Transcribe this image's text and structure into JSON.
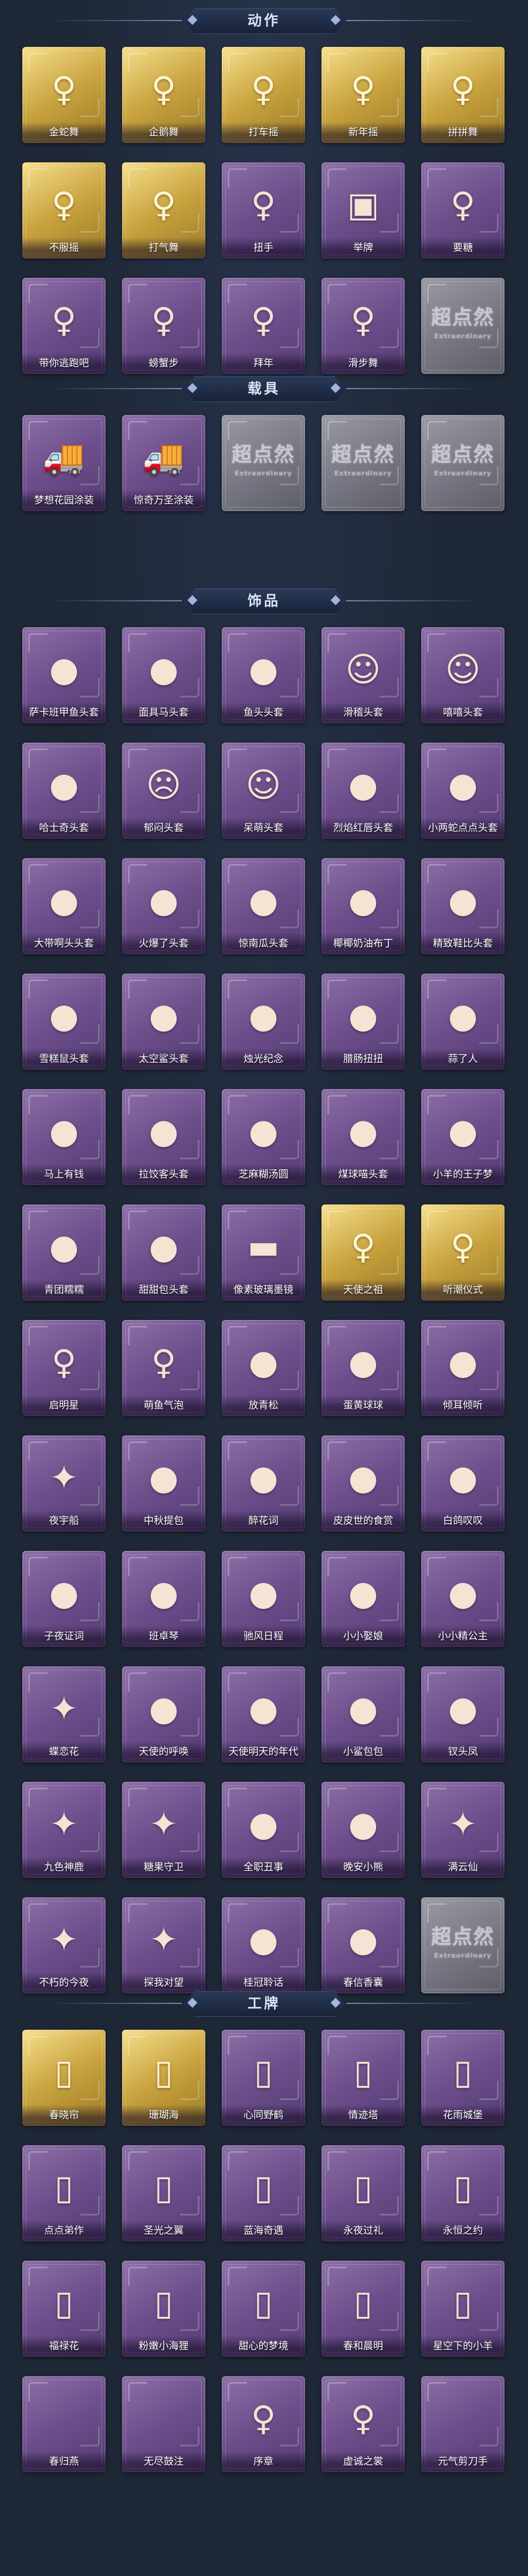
{
  "placeholder": {
    "text": "超点然",
    "sub": "Extraordinary"
  },
  "sections": [
    {
      "title": "动作",
      "items": [
        {
          "label": "金蛇舞",
          "style": "gold",
          "icon": "♀"
        },
        {
          "label": "企鹅舞",
          "style": "gold",
          "icon": "♀"
        },
        {
          "label": "打车摇",
          "style": "gold",
          "icon": "♀"
        },
        {
          "label": "新年摇",
          "style": "gold",
          "icon": "♀"
        },
        {
          "label": "拼拼舞",
          "style": "gold",
          "icon": "♀"
        },
        {
          "label": "不服摇",
          "style": "gold",
          "icon": "♀"
        },
        {
          "label": "打气舞",
          "style": "gold",
          "icon": "♀"
        },
        {
          "label": "扭手",
          "style": "purple",
          "icon": "♀"
        },
        {
          "label": "举牌",
          "style": "purple",
          "icon": "▣"
        },
        {
          "label": "要糖",
          "style": "purple",
          "icon": "♀"
        },
        {
          "label": "带你逃跑吧",
          "style": "purple",
          "icon": "♀"
        },
        {
          "label": "螃蟹步",
          "style": "purple",
          "icon": "♀"
        },
        {
          "label": "拜年",
          "style": "purple",
          "icon": "♀"
        },
        {
          "label": "滑步舞",
          "style": "purple",
          "icon": "♀"
        },
        {
          "label": "",
          "style": "grey",
          "icon": "",
          "placeholder": true
        }
      ]
    },
    {
      "title": "载具",
      "items": [
        {
          "label": "梦想花园涂装",
          "style": "purple",
          "icon": "🚚"
        },
        {
          "label": "惊奇万圣涂装",
          "style": "purple",
          "icon": "🚚"
        },
        {
          "label": "",
          "style": "grey",
          "icon": "",
          "placeholder": true
        },
        {
          "label": "",
          "style": "grey",
          "icon": "",
          "placeholder": true
        },
        {
          "label": "",
          "style": "grey",
          "icon": "",
          "placeholder": true
        }
      ]
    },
    {
      "title": "饰品",
      "items": [
        {
          "label": "萨卡班甲鱼头套",
          "style": "purple",
          "icon": "●"
        },
        {
          "label": "面具马头套",
          "style": "purple",
          "icon": "●"
        },
        {
          "label": "鱼头头套",
          "style": "purple",
          "icon": "●"
        },
        {
          "label": "滑稽头套",
          "style": "purple",
          "icon": "☺"
        },
        {
          "label": "嘻嘻头套",
          "style": "purple",
          "icon": "☺"
        },
        {
          "label": "哈士奇头套",
          "style": "purple",
          "icon": "●"
        },
        {
          "label": "郁闷头套",
          "style": "purple",
          "icon": "☹"
        },
        {
          "label": "呆萌头套",
          "style": "purple",
          "icon": "☺"
        },
        {
          "label": "烈焰红唇头套",
          "style": "purple",
          "icon": "●"
        },
        {
          "label": "小两蛇点点头套",
          "style": "purple",
          "icon": "●"
        },
        {
          "label": "大带啊头头套",
          "style": "purple",
          "icon": "●"
        },
        {
          "label": "火爆了头套",
          "style": "purple",
          "icon": "●"
        },
        {
          "label": "惊南瓜头套",
          "style": "purple",
          "icon": "●"
        },
        {
          "label": "椰椰奶油布丁",
          "style": "purple",
          "icon": "●"
        },
        {
          "label": "精致鞋比头套",
          "style": "purple",
          "icon": "●"
        },
        {
          "label": "雪糕鼠头套",
          "style": "purple",
          "icon": "●"
        },
        {
          "label": "太空鲨头套",
          "style": "purple",
          "icon": "●"
        },
        {
          "label": "烛光纪念",
          "style": "purple",
          "icon": "●"
        },
        {
          "label": "腊肠扭扭",
          "style": "purple",
          "icon": "●"
        },
        {
          "label": "蒜了人",
          "style": "purple",
          "icon": "●"
        },
        {
          "label": "马上有钱",
          "style": "purple",
          "icon": "●"
        },
        {
          "label": "拉饺客头套",
          "style": "purple",
          "icon": "●"
        },
        {
          "label": "芝麻糊汤圆",
          "style": "purple",
          "icon": "●"
        },
        {
          "label": "煤球喵头套",
          "style": "purple",
          "icon": "●"
        },
        {
          "label": "小羊的王子梦",
          "style": "purple",
          "icon": "●"
        },
        {
          "label": "青团糯糯",
          "style": "purple",
          "icon": "●"
        },
        {
          "label": "甜甜包头套",
          "style": "purple",
          "icon": "●"
        },
        {
          "label": "像素玻璃墨镜",
          "style": "purple",
          "icon": "▬"
        },
        {
          "label": "天使之祖",
          "style": "gold",
          "icon": "♀"
        },
        {
          "label": "听潮仪式",
          "style": "gold",
          "icon": "♀"
        },
        {
          "label": "启明星",
          "style": "purple",
          "icon": "♀"
        },
        {
          "label": "萌鱼气泡",
          "style": "purple",
          "icon": "♀"
        },
        {
          "label": "放青松",
          "style": "purple",
          "icon": "●"
        },
        {
          "label": "蛋黄球球",
          "style": "purple",
          "icon": "●"
        },
        {
          "label": "倾耳倾听",
          "style": "purple",
          "icon": "●"
        },
        {
          "label": "夜宇船",
          "style": "purple",
          "icon": "✦"
        },
        {
          "label": "中秋提包",
          "style": "purple",
          "icon": "●"
        },
        {
          "label": "醉花词",
          "style": "purple",
          "icon": "●"
        },
        {
          "label": "皮皮世的食赏",
          "style": "purple",
          "icon": "●"
        },
        {
          "label": "白鸽叹叹",
          "style": "purple",
          "icon": "●"
        },
        {
          "label": "子夜证词",
          "style": "purple",
          "icon": "●"
        },
        {
          "label": "班卓琴",
          "style": "purple",
          "icon": "●"
        },
        {
          "label": "驰风日程",
          "style": "purple",
          "icon": "●"
        },
        {
          "label": "小小娶娘",
          "style": "purple",
          "icon": "●"
        },
        {
          "label": "小小精公主",
          "style": "purple",
          "icon": "●"
        },
        {
          "label": "蝶恋花",
          "style": "purple",
          "icon": "✦"
        },
        {
          "label": "天使的呼唤",
          "style": "purple",
          "icon": "●"
        },
        {
          "label": "天使明天的年代",
          "style": "purple",
          "icon": "●"
        },
        {
          "label": "小鲨包包",
          "style": "purple",
          "icon": "●"
        },
        {
          "label": "钗头凤",
          "style": "purple",
          "icon": "●"
        },
        {
          "label": "九色神鹿",
          "style": "purple",
          "icon": "✦"
        },
        {
          "label": "糖果守卫",
          "style": "purple",
          "icon": "✦"
        },
        {
          "label": "全职丑事",
          "style": "purple",
          "icon": "●"
        },
        {
          "label": "晚安小熊",
          "style": "purple",
          "icon": "●"
        },
        {
          "label": "满云仙",
          "style": "purple",
          "icon": "✦"
        },
        {
          "label": "不朽的今夜",
          "style": "purple",
          "icon": "✦"
        },
        {
          "label": "探我对望",
          "style": "purple",
          "icon": "✦"
        },
        {
          "label": "桂冠聆话",
          "style": "purple",
          "icon": "●"
        },
        {
          "label": "春信香囊",
          "style": "purple",
          "icon": "●"
        },
        {
          "label": "",
          "style": "grey",
          "icon": "",
          "placeholder": true
        }
      ]
    },
    {
      "title": "工牌",
      "items": [
        {
          "label": "春晓帘",
          "style": "gold",
          "icon": "▯"
        },
        {
          "label": "珊瑚海",
          "style": "gold",
          "icon": "▯"
        },
        {
          "label": "心同野鹤",
          "style": "purple",
          "icon": "▯"
        },
        {
          "label": "情迹塔",
          "style": "purple",
          "icon": "▯"
        },
        {
          "label": "花雨城堡",
          "style": "purple",
          "icon": "▯"
        },
        {
          "label": "点点弟作",
          "style": "purple",
          "icon": "▯"
        },
        {
          "label": "圣光之翼",
          "style": "purple",
          "icon": "▯"
        },
        {
          "label": "蓝海奇遇",
          "style": "purple",
          "icon": "▯"
        },
        {
          "label": "永夜过礼",
          "style": "purple",
          "icon": "▯"
        },
        {
          "label": "永恒之约",
          "style": "purple",
          "icon": "▯"
        },
        {
          "label": "福禄花",
          "style": "purple",
          "icon": "▯"
        },
        {
          "label": "粉嫩小海狸",
          "style": "purple",
          "icon": "▯"
        },
        {
          "label": "甜心的梦境",
          "style": "purple",
          "icon": "▯"
        },
        {
          "label": "春和晨明",
          "style": "purple",
          "icon": "▯"
        },
        {
          "label": "星空下的小羊",
          "style": "purple",
          "icon": "▯"
        },
        {
          "label": "春归燕",
          "style": "purple",
          "icon": ""
        },
        {
          "label": "无尽鼓注",
          "style": "purple",
          "icon": ""
        },
        {
          "label": "序章",
          "style": "purple",
          "icon": "♀"
        },
        {
          "label": "虚诚之裳",
          "style": "purple",
          "icon": "♀"
        },
        {
          "label": "元气剪刀手",
          "style": "purple",
          "icon": ""
        }
      ]
    }
  ]
}
